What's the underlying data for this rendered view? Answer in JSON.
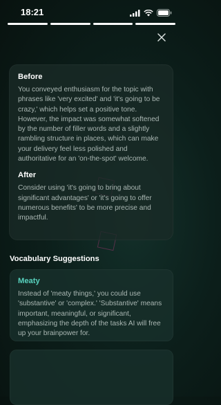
{
  "status_bar": {
    "time": "18:21",
    "icons": [
      "signal-icon",
      "wifi-icon",
      "battery-icon"
    ]
  },
  "progress": {
    "segments": 4,
    "active": 4
  },
  "header": {
    "close_icon": "close-icon"
  },
  "feedback": {
    "before_title": "Before",
    "before_text": "You conveyed enthusiasm for the topic with phrases like 'very excited' and 'it's going to be crazy,' which helps set a positive tone. However, the impact was somewhat softened by the number of filler words and a slightly rambling structure in places, which can make your delivery feel less polished and authoritative for an 'on-the-spot' welcome.",
    "after_title": "After",
    "after_text": "Consider using 'it's going to bring about significant advantages' or 'it's going to offer numerous benefits' to be more precise and impactful."
  },
  "vocabulary": {
    "title": "Vocabulary Suggestions",
    "items": [
      {
        "word": "Meaty",
        "description": "Instead of 'meaty things,' you could use 'substantive' or 'complex.' 'Substantive' means important, meaningful, or significant, emphasizing the depth of the tasks AI will free up your brainpower for."
      }
    ]
  },
  "colors": {
    "accent": "#58d2be",
    "background": "#0c1f1b",
    "card": "#1a2a27",
    "body_text": "#aab7b3"
  }
}
